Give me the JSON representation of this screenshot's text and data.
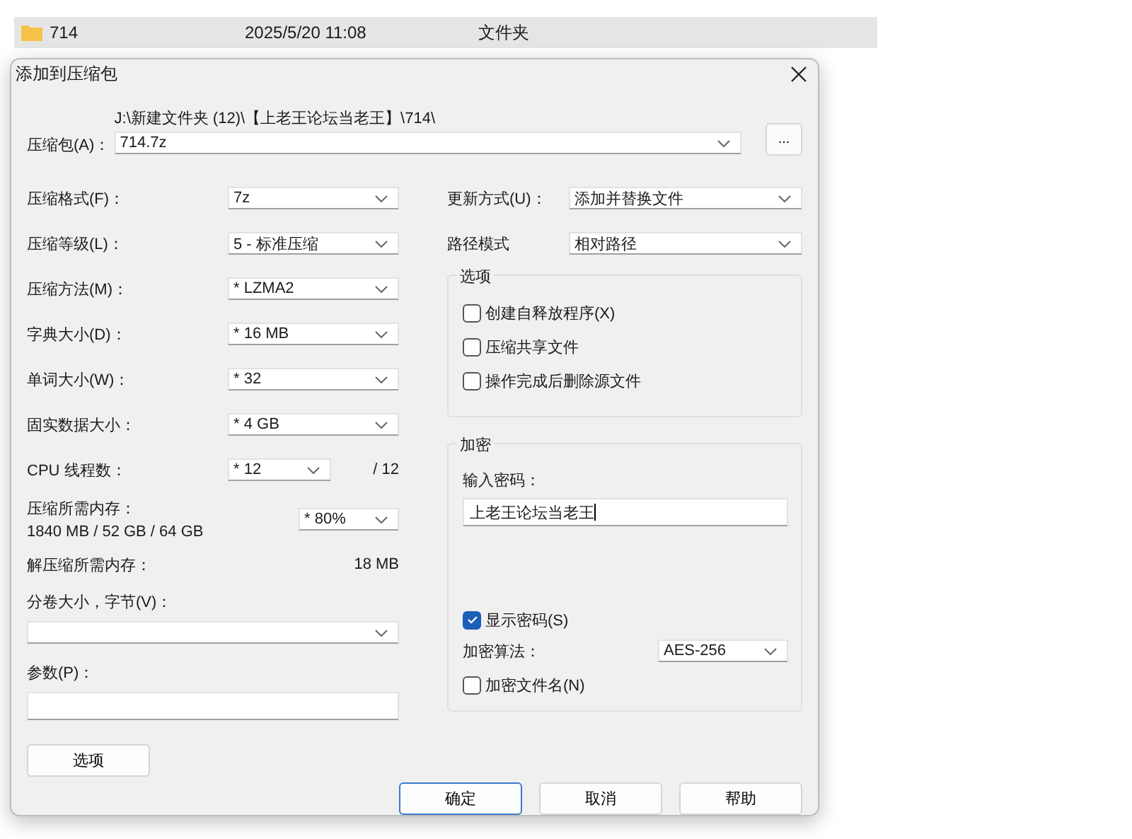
{
  "file_row": {
    "name": "714",
    "modified": "2025/5/20 11:08",
    "type": "文件夹"
  },
  "dialog": {
    "title": "添加到压缩包",
    "archive": {
      "label": "压缩包(A)：",
      "path": "J:\\新建文件夹 (12)\\【上老王论坛当老王】\\714\\",
      "value": "714.7z",
      "browse": "..."
    },
    "left_fields": [
      {
        "kind": "select",
        "label": "压缩格式(F)：",
        "value": "7z"
      },
      {
        "kind": "select",
        "label": "压缩等级(L)：",
        "value": "5 - 标准压缩"
      },
      {
        "kind": "select",
        "label": "压缩方法(M)：",
        "value": "* LZMA2"
      },
      {
        "kind": "select",
        "label": "字典大小(D)：",
        "value": "* 16 MB"
      },
      {
        "kind": "select",
        "label": "单词大小(W)：",
        "value": "* 32"
      },
      {
        "kind": "select",
        "label": "固实数据大小：",
        "value": "* 4 GB"
      },
      {
        "kind": "cpu",
        "label": "CPU 线程数：",
        "value": "* 12",
        "note": "/ 12"
      },
      {
        "kind": "memory",
        "label": "压缩所需内存：",
        "sub": "1840 MB / 52 GB / 64 GB",
        "value": "* 80%"
      },
      {
        "kind": "info",
        "label": "解压缩所需内存：",
        "note": "18 MB"
      }
    ],
    "volume": {
      "label": "分卷大小，字节(V)："
    },
    "params": {
      "label": "参数(P)："
    },
    "options_button": "选项",
    "right_fields": [
      {
        "label": "更新方式(U)：",
        "value": "添加并替换文件"
      },
      {
        "label": "路径模式",
        "value": "相对路径"
      }
    ],
    "options_group": {
      "title": "选项",
      "checkboxes": [
        {
          "label": "创建自释放程序(X)",
          "checked": false
        },
        {
          "label": "压缩共享文件",
          "checked": false
        },
        {
          "label": "操作完成后删除源文件",
          "checked": false
        }
      ]
    },
    "encryption": {
      "title": "加密",
      "password_label": "输入密码：",
      "password": "上老王论坛当老王",
      "show_password": {
        "label": "显示密码(S)",
        "checked": true
      },
      "method_label": "加密算法：",
      "method": "AES-256",
      "encrypt_names": {
        "label": "加密文件名(N)",
        "checked": false
      }
    },
    "buttons": [
      {
        "label": "确定",
        "default": true
      },
      {
        "label": "取消",
        "default": false
      },
      {
        "label": "帮助",
        "default": false
      }
    ]
  }
}
